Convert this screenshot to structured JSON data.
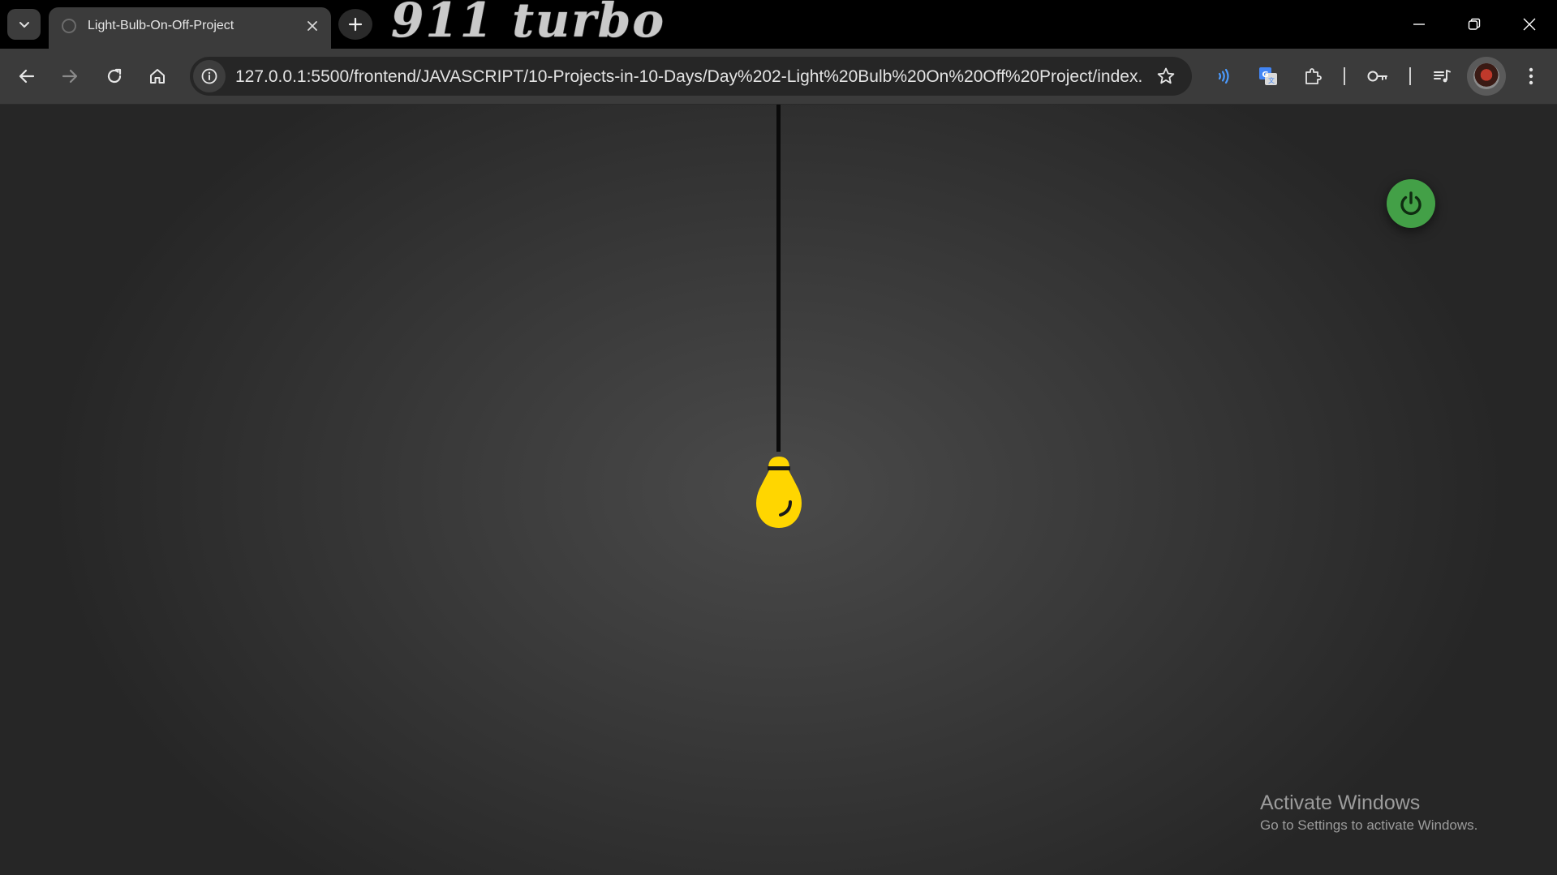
{
  "tab": {
    "title": "Light-Bulb-On-Off-Project"
  },
  "theme": {
    "logo_text": "911 turbo"
  },
  "address_bar": {
    "url": "127.0.0.1:5500/frontend/JAVASCRIPT/10-Projects-in-10-Days/Day%202-Light%20Bulb%20On%20Off%20Project/index...."
  },
  "colors": {
    "bulb": "#ffd600",
    "power_button": "#43a047",
    "page_background": "#3a3a3a"
  },
  "icons": {
    "tab_search": "chevron-down-icon",
    "favicon": "globe-icon",
    "tab_close": "close-icon",
    "new_tab": "plus-icon",
    "back": "arrow-left-icon",
    "forward": "arrow-right-icon",
    "reload": "reload-icon",
    "home": "home-icon",
    "site_info": "info-icon",
    "bookmark": "star-icon",
    "read_aloud": "sound-wave-icon",
    "translate": "translate-icon",
    "extensions": "puzzle-icon",
    "passwords": "key-icon",
    "media": "playlist-icon",
    "menu": "kebab-menu-icon",
    "power": "power-icon"
  },
  "watermark": {
    "title": "Activate Windows",
    "subtitle": "Go to Settings to activate Windows."
  }
}
